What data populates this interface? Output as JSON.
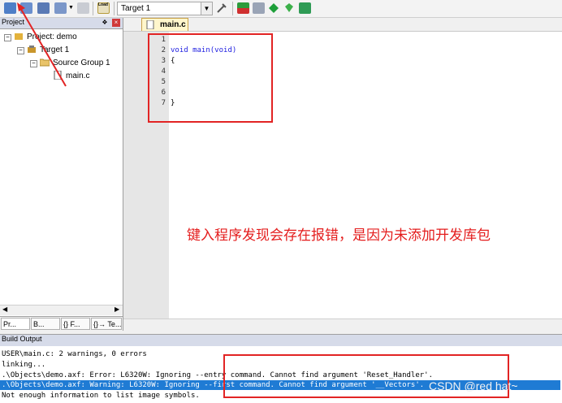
{
  "toolbar": {
    "target": "Target 1",
    "load_label": "Load"
  },
  "project": {
    "header": "Project",
    "pin_glyph": "❖",
    "close_glyph": "×",
    "tree": {
      "root": "Project: demo",
      "target": "Target 1",
      "group": "Source Group 1",
      "file": "main.c"
    },
    "tabs": [
      "Pr...",
      "B...",
      "{} F...",
      "{}→ Te..."
    ]
  },
  "editor": {
    "tab": "main.c",
    "line_numbers": [
      "1",
      "2",
      "3",
      "4",
      "5",
      "6",
      "7"
    ],
    "lines": [
      "",
      "void main(void)",
      "{",
      "",
      "",
      "",
      "}"
    ]
  },
  "annotation": {
    "text": "键入程序发现会存在报错，是因为未添加开发库包"
  },
  "build": {
    "header": "Build Output",
    "lines": [
      "USER\\main.c: 2 warnings, 0 errors",
      "linking...",
      ".\\Objects\\demo.axf: Error: L6320W: Ignoring --entry command. Cannot find argument 'Reset_Handler'.",
      ".\\Objects\\demo.axf: Warning: L6320W: Ignoring --first command. Cannot find argument '__Vectors'.",
      "Not enough information to list image symbols."
    ]
  },
  "watermark": "CSDN @red hat~",
  "colors": {
    "annotation_red": "#e22424",
    "selection_blue": "#1f7bd4",
    "keyword_blue": "#1d1de0"
  }
}
